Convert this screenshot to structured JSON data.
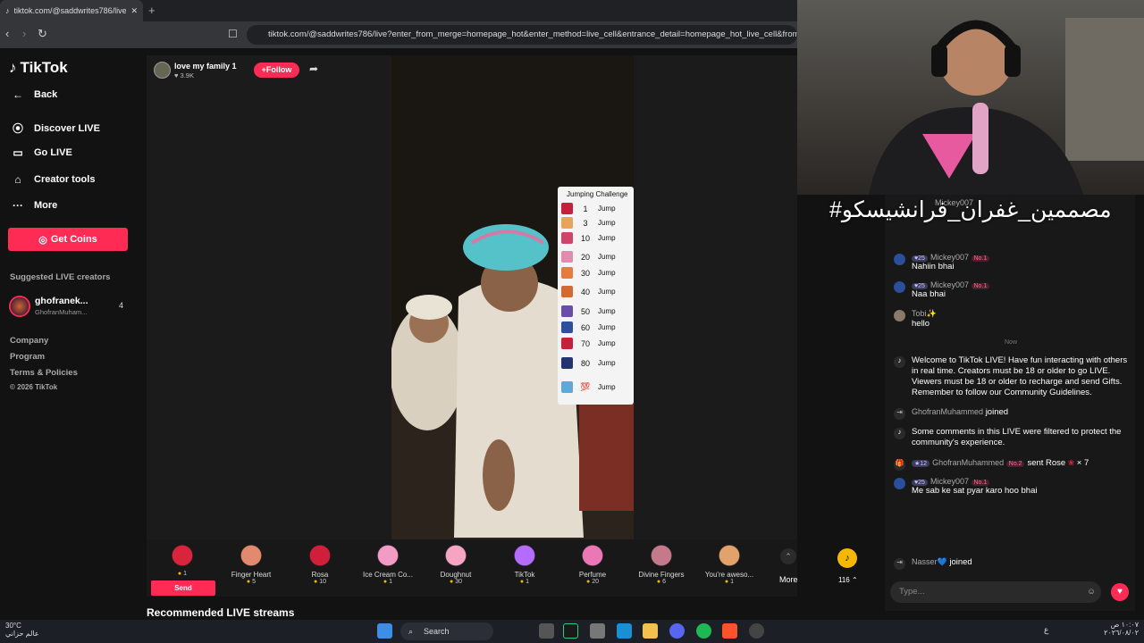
{
  "browser": {
    "tab_title": "tiktok.com/@saddwrites786/live",
    "tab_close": "✕",
    "new_tab": "+",
    "url": "tiktok.com/@saddwrites786/live?enter_from_merge=homepage_hot&enter_method=live_cell&entrance_detail=homepage_hot_live_cell&from_"
  },
  "sidebar": {
    "logo": "TikTok",
    "back": "Back",
    "items": [
      {
        "label": "Discover LIVE",
        "icon": "live-icon"
      },
      {
        "label": "Go LIVE",
        "icon": "camera-icon"
      },
      {
        "label": "Creator tools",
        "icon": "home-icon"
      },
      {
        "label": "More",
        "icon": "more-icon"
      }
    ],
    "get_coins": "Get Coins",
    "suggested_title": "Suggested LIVE creators",
    "suggested": {
      "name": "ghofranek...",
      "handle": "GhofranMuham...",
      "count": "4"
    },
    "footer": [
      "Company",
      "Program",
      "Terms & Policies",
      "© 2026 TikTok"
    ]
  },
  "stream": {
    "host_name": "love my family 1",
    "likes": "3.9K",
    "follow": "+Follow",
    "recommended": "Recommended LIVE streams",
    "challenge": {
      "title": "Jumping Challenge",
      "rows": [
        {
          "n": "1",
          "jump": "Jump",
          "color": "#c8203a"
        },
        {
          "n": "3",
          "jump": "Jump",
          "color": "#e9a45a"
        },
        {
          "n": "10",
          "jump": "Jump",
          "color": "#d0436b"
        },
        {
          "n": "20",
          "jump": "Jump",
          "color": "#e28bb0"
        },
        {
          "n": "30",
          "jump": "Jump",
          "color": "#e87b3c"
        },
        {
          "n": "40",
          "jump": "Jump",
          "color": "#d46a33"
        },
        {
          "n": "50",
          "jump": "Jump",
          "color": "#6b4ca8"
        },
        {
          "n": "60",
          "jump": "Jump",
          "color": "#2f4f9a"
        },
        {
          "n": "70",
          "jump": "Jump",
          "color": "#c8203a"
        },
        {
          "n": "80",
          "jump": "Jump",
          "color": "#233570"
        },
        {
          "n": "💯",
          "jump": "Jump",
          "color": "#5da9d9"
        }
      ]
    }
  },
  "gifts": [
    {
      "name": "",
      "price": "1",
      "color": "#d8243c"
    },
    {
      "name": "Finger Heart",
      "price": "5",
      "color": "#e38a6e"
    },
    {
      "name": "Rosa",
      "price": "10",
      "color": "#d11e3a"
    },
    {
      "name": "Ice Cream Co...",
      "price": "1",
      "color": "#f29bc4"
    },
    {
      "name": "Doughnut",
      "price": "30",
      "color": "#f5a4c2"
    },
    {
      "name": "TikTok",
      "price": "1",
      "color": "#b46bff"
    },
    {
      "name": "Perfume",
      "price": "20",
      "color": "#ea77b6"
    },
    {
      "name": "Divine Fingers",
      "price": "6",
      "color": "#c47a8b"
    },
    {
      "name": "You're aweso...",
      "price": "1",
      "color": "#e1a26c"
    }
  ],
  "gift_bar": {
    "send": "Send",
    "more": "More",
    "coins": "116"
  },
  "overlay_text": "#مصممين_غفران_فرانشيسكو",
  "chat": {
    "top_user": "Mickey007",
    "messages": [
      {
        "user": "Mickey007",
        "level": "25",
        "rank": "No.1",
        "text": "Nahiin bhai"
      },
      {
        "user": "Mickey007",
        "level": "25",
        "rank": "No.1",
        "text": "Naa bhai"
      },
      {
        "user": "Tobi✨",
        "level": "",
        "rank": "",
        "text": "hello"
      }
    ],
    "now": "Now",
    "welcome": "Welcome to TikTok LIVE! Have fun interacting with others in real time. Creators must be 18 or older to go LIVE. Viewers must be 18 or older to recharge and send Gifts. Remember to follow our Community Guidelines.",
    "joined1_user": "GhofranMuhammed",
    "joined_label": "joined",
    "filtered": "Some comments in this LIVE were filtered to protect the community's experience.",
    "gift_msg": {
      "user": "GhofranMuhammed",
      "level": "12",
      "rank": "No.2",
      "text": "sent Rose",
      "count": "× 7"
    },
    "last": {
      "user": "Mickey007",
      "level": "25",
      "rank": "No.1",
      "text": "Me sab ke sat pyar karo hoo bhai"
    },
    "joined2_user": "Nasser💙",
    "placeholder": "Type..."
  },
  "taskbar": {
    "temp": "30°C",
    "weather_desc": "عالم حزاني",
    "search": "Search",
    "lang": "ع",
    "time": "١٠:٠٧ ص",
    "date": "٢٠٢٦/٠٨/٠٢"
  }
}
